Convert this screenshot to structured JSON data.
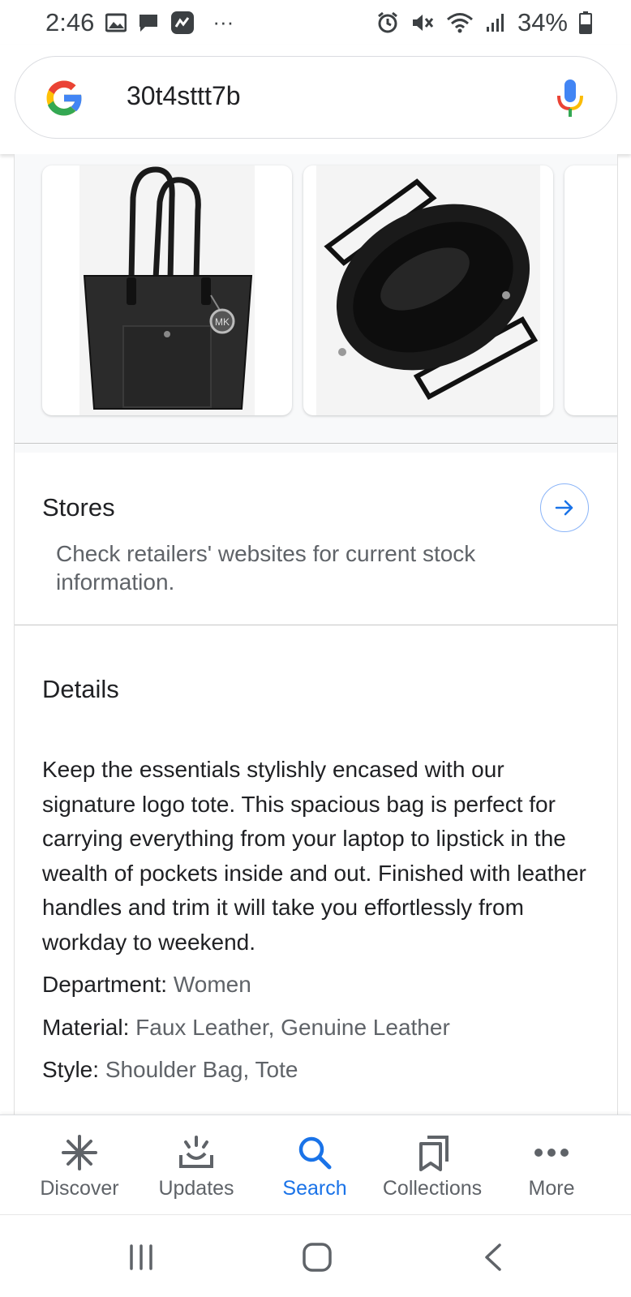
{
  "status_bar": {
    "time": "2:46",
    "more": "···",
    "battery": "34%"
  },
  "search": {
    "query": "30t4sttt7b"
  },
  "stores": {
    "title": "Stores",
    "info": "Check retailers' websites for current stock information."
  },
  "details": {
    "title": "Details",
    "description": "Keep the essentials stylishly encased with our signature logo tote. This spacious bag is perfect for carrying everything from your laptop to lipstick in the wealth of pockets inside and out. Finished with leather handles and trim it will take you effortlessly from workday to weekend.",
    "attributes": [
      {
        "label": "Department",
        "value": "Women"
      },
      {
        "label": "Material",
        "value": "Faux Leather, Genuine Leather"
      },
      {
        "label": "Style",
        "value": "Shoulder Bag, Tote"
      }
    ]
  },
  "bottom_nav": {
    "items": [
      {
        "label": "Discover",
        "icon": "asterisk-icon",
        "active": false
      },
      {
        "label": "Updates",
        "icon": "updates-icon",
        "active": false
      },
      {
        "label": "Search",
        "icon": "search-icon",
        "active": true
      },
      {
        "label": "Collections",
        "icon": "collections-icon",
        "active": false
      },
      {
        "label": "More",
        "icon": "more-dots-icon",
        "active": false
      }
    ]
  },
  "colors": {
    "accent": "#1a73e8",
    "text": "#202124",
    "muted": "#5f6368"
  }
}
